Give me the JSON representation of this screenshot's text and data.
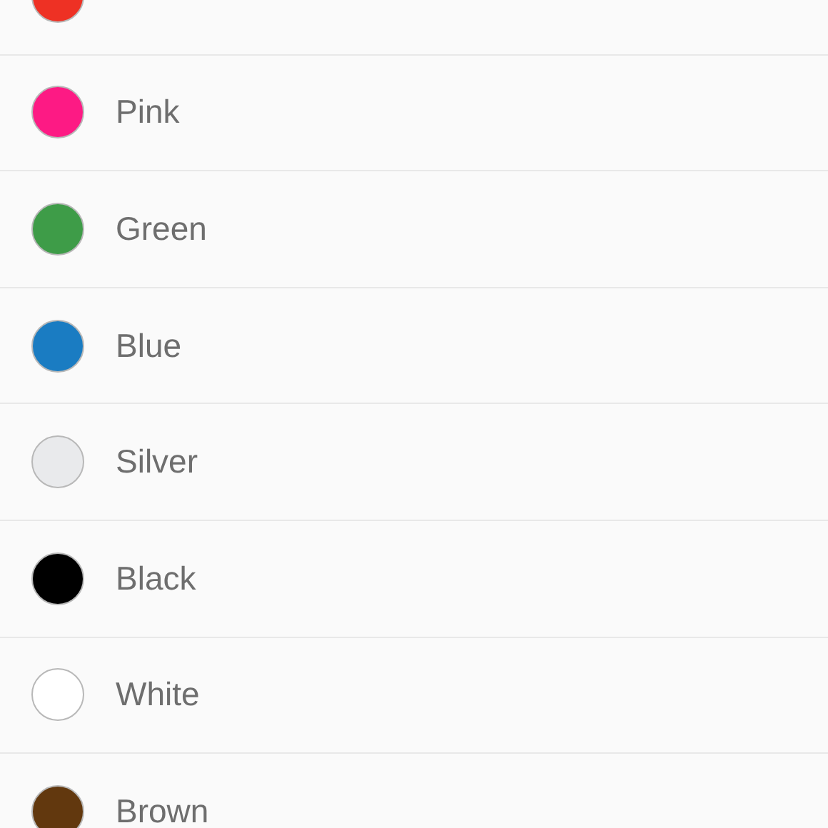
{
  "colors": [
    {
      "color": "#ee3124"
    },
    {
      "name": "Pink",
      "color": "#fd1a84"
    },
    {
      "name": "Green",
      "color": "#3e9c48"
    },
    {
      "name": "Blue",
      "color": "#1a7cc2"
    },
    {
      "name": "Silver",
      "color": "#e9eaec"
    },
    {
      "name": "Black",
      "color": "#000000"
    },
    {
      "name": "White",
      "color": "#ffffff"
    },
    {
      "name": "Brown",
      "color": "#62380e"
    }
  ]
}
